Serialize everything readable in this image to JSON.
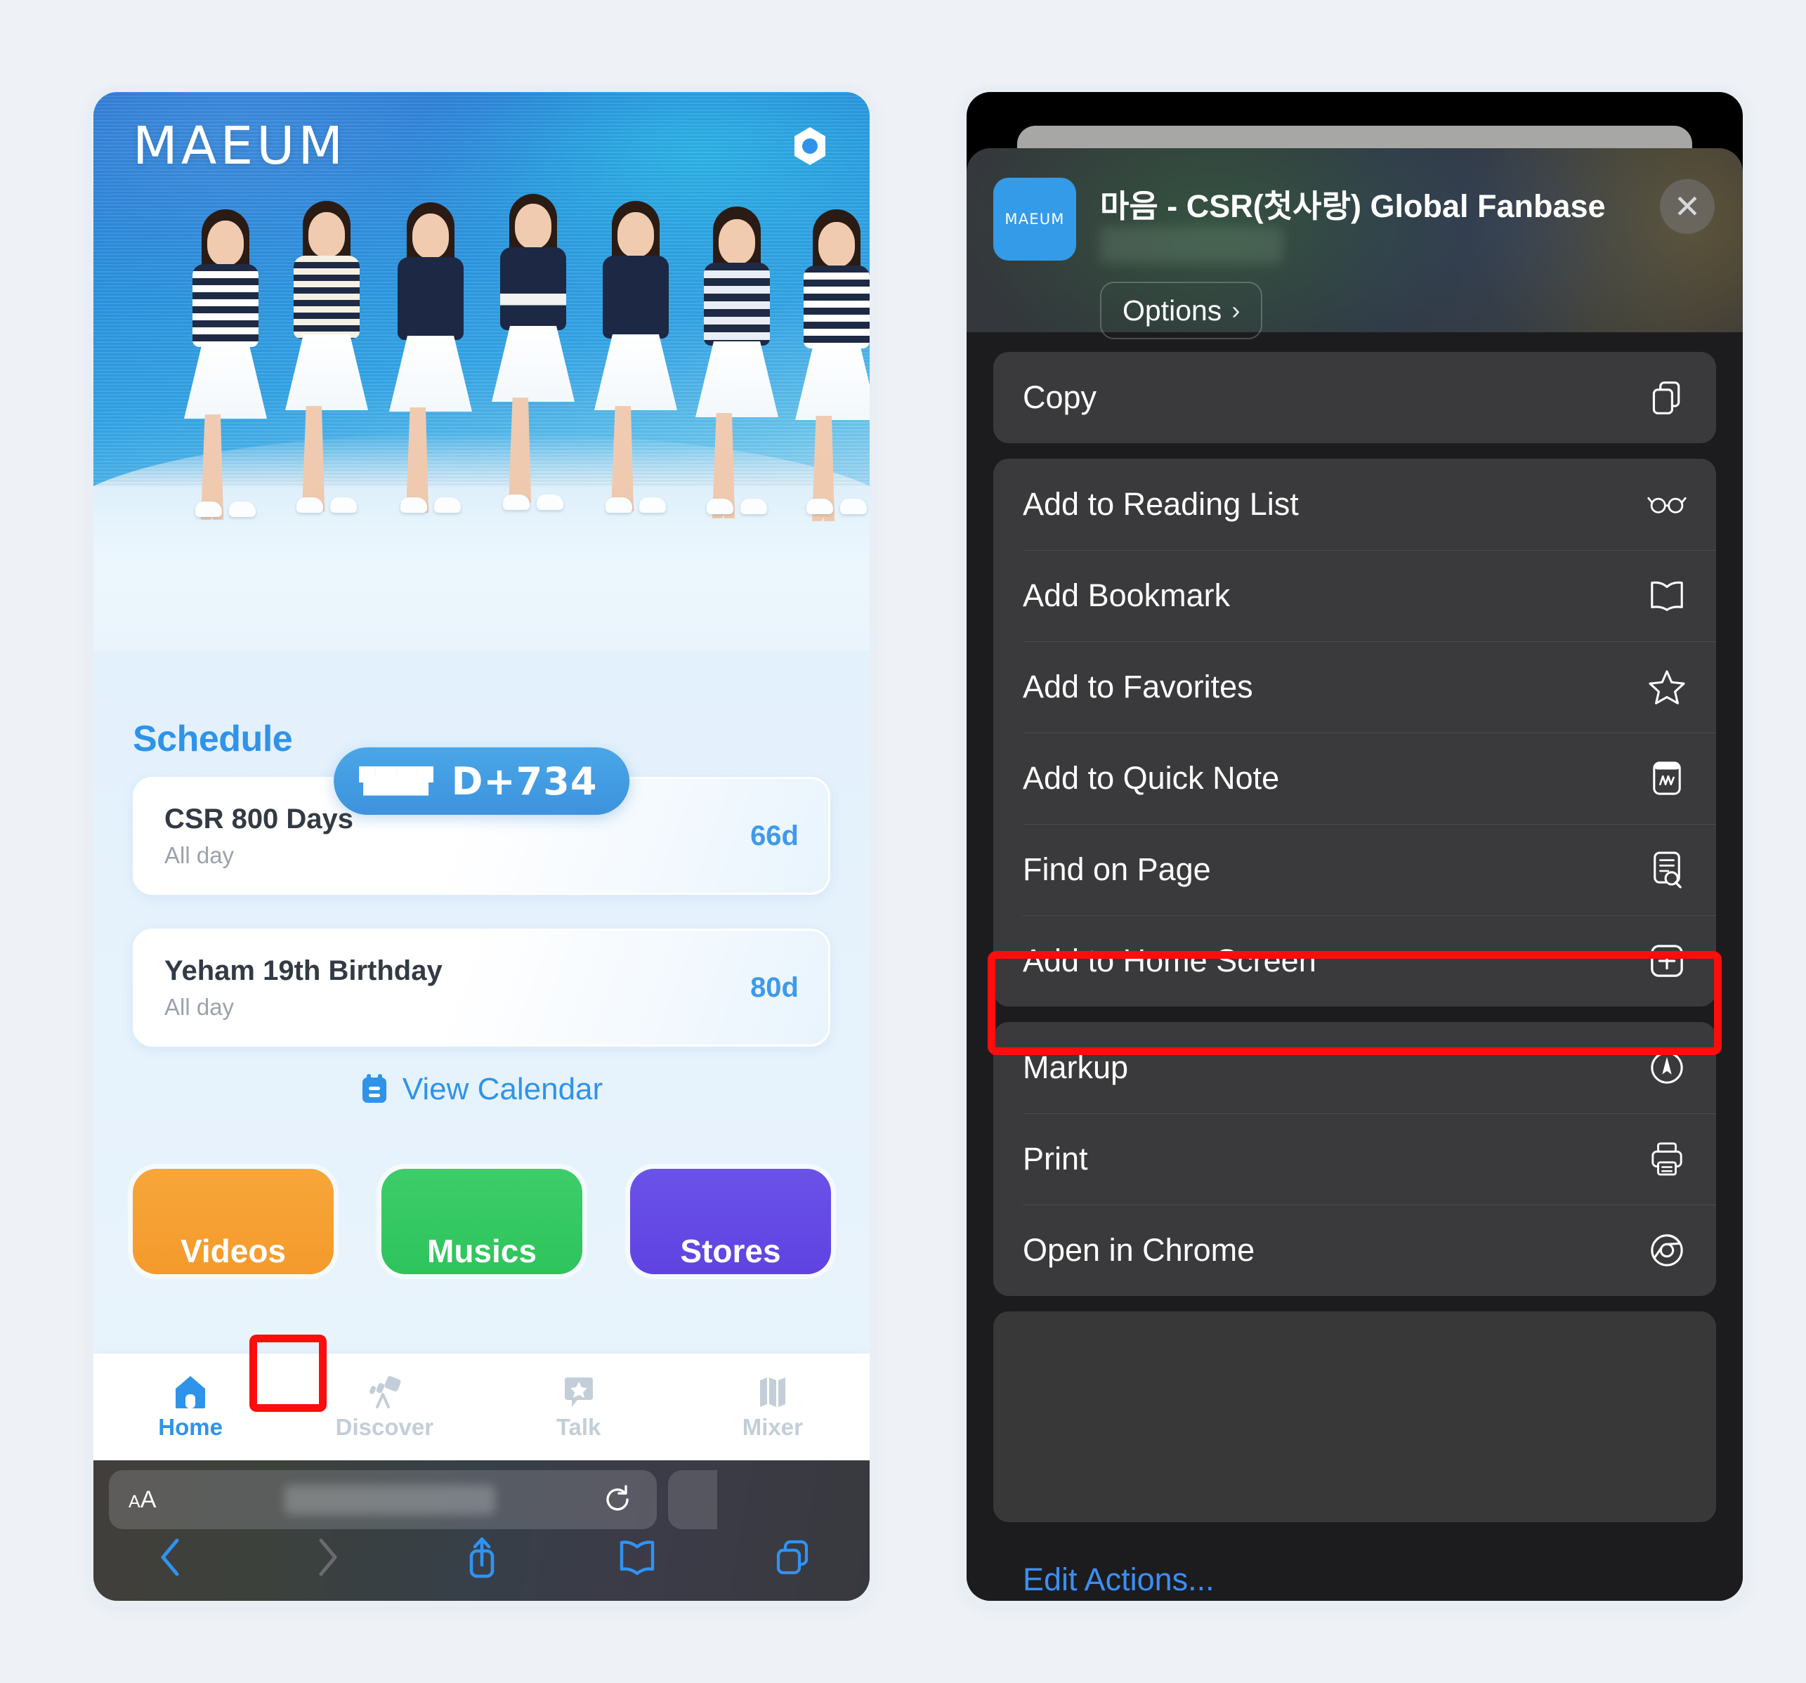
{
  "page": {
    "background_color": "#eef2f7"
  },
  "left_phone": {
    "app": {
      "wordmark": "MAEUM",
      "settings_icon": "hex-nut-settings-icon",
      "dday": {
        "label": "D+734",
        "hearts_icon": "three-hearts-icon",
        "badge_color": "#4aa6e8"
      },
      "schedule": {
        "title": "Schedule",
        "items": [
          {
            "name": "CSR 800 Days",
            "time": "All day",
            "days_left": "66d"
          },
          {
            "name": "Yeham 19th Birthday",
            "time": "All day",
            "days_left": "80d"
          }
        ],
        "view_calendar_label": "View Calendar",
        "view_calendar_icon": "calendar-icon"
      },
      "categories": [
        {
          "label": "Videos",
          "color": "#f7a63a"
        },
        {
          "label": "Musics",
          "color": "#3dcd6a"
        },
        {
          "label": "Stores",
          "color": "#6a52e8"
        }
      ],
      "tabs": [
        {
          "label": "Home",
          "icon": "home-icon",
          "active": true
        },
        {
          "label": "Discover",
          "icon": "telescope-icon",
          "active": false
        },
        {
          "label": "Talk",
          "icon": "chat-star-icon",
          "active": false
        },
        {
          "label": "Mixer",
          "icon": "mixer-icon",
          "active": false
        }
      ]
    },
    "safari": {
      "text_size_label": "AA",
      "text_size_icon": "text-size-icon",
      "url_value": "",
      "reload_icon": "reload-icon",
      "actions": [
        {
          "name": "back",
          "icon": "chevron-left-icon",
          "enabled": true
        },
        {
          "name": "forward",
          "icon": "chevron-right-icon",
          "enabled": false
        },
        {
          "name": "share",
          "icon": "share-icon",
          "enabled": true,
          "highlighted": true
        },
        {
          "name": "bookmarks",
          "icon": "book-icon",
          "enabled": true
        },
        {
          "name": "tabs",
          "icon": "tabs-icon",
          "enabled": true
        }
      ],
      "highlight_color": "#ff0d0d"
    }
  },
  "right_phone": {
    "share_sheet": {
      "app_icon_label": "MAEUM",
      "app_icon_color": "#339be8",
      "title": "마음 - CSR(첫사랑) Global Fanbase",
      "url_blurred": true,
      "options_label": "Options",
      "options_chevron": "chevron-right-icon",
      "close_icon": "close-icon",
      "groups": [
        {
          "rows": [
            {
              "label": "Copy",
              "icon": "copy-icon",
              "blurred": false,
              "highlighted": false
            }
          ]
        },
        {
          "rows": [
            {
              "label": "Add to Reading List",
              "icon": "glasses-icon",
              "blurred": false,
              "highlighted": false
            },
            {
              "label": "Add Bookmark",
              "icon": "book-icon",
              "blurred": false,
              "highlighted": false
            },
            {
              "label": "Add to Favorites",
              "icon": "star-icon",
              "blurred": false,
              "highlighted": false
            },
            {
              "label": "Add to Quick Note",
              "icon": "quick-note-icon",
              "blurred": false,
              "highlighted": false
            },
            {
              "label": "Find on Page",
              "icon": "find-page-icon",
              "blurred": false,
              "highlighted": false
            },
            {
              "label": "Add to Home Screen",
              "icon": "plus-square-icon",
              "blurred": false,
              "highlighted": true
            }
          ]
        },
        {
          "rows": [
            {
              "label": "Markup",
              "icon": "markup-icon",
              "blurred": false,
              "highlighted": false
            },
            {
              "label": "Print",
              "icon": "printer-icon",
              "blurred": false,
              "highlighted": false
            },
            {
              "label": "Open in Chrome",
              "icon": "chrome-icon",
              "blurred": false,
              "highlighted": false
            }
          ]
        }
      ],
      "edit_actions_label": "Edit Actions...",
      "edit_actions_color": "#3b8ff5",
      "highlight_color": "#ff0d0d"
    }
  }
}
